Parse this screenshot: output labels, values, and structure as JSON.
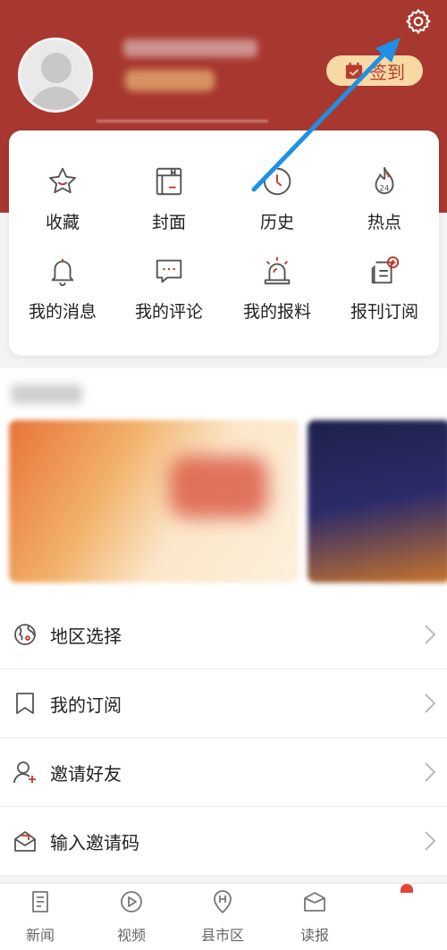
{
  "header": {
    "signin_label": "签到",
    "icons": [
      "settings-gear-icon",
      "calendar-check-icon"
    ]
  },
  "quick_grid": [
    {
      "label": "收藏",
      "icon": "star-icon"
    },
    {
      "label": "封面",
      "icon": "newspaper-cover-icon"
    },
    {
      "label": "历史",
      "icon": "clock-icon"
    },
    {
      "label": "热点",
      "icon": "flame-24-icon"
    },
    {
      "label": "我的消息",
      "icon": "bell-icon"
    },
    {
      "label": "我的评论",
      "icon": "comment-bubble-icon"
    },
    {
      "label": "我的报料",
      "icon": "siren-icon"
    },
    {
      "label": "报刊订阅",
      "icon": "paper-subscribe-icon"
    }
  ],
  "menu": [
    {
      "label": "地区选择",
      "icon": "globe-location-icon"
    },
    {
      "label": "我的订阅",
      "icon": "bookmark-icon"
    },
    {
      "label": "邀请好友",
      "icon": "add-user-icon"
    },
    {
      "label": "输入邀请码",
      "icon": "invite-code-icon"
    }
  ],
  "tabbar": [
    {
      "label": "新闻",
      "icon": "news-doc-icon"
    },
    {
      "label": "视频",
      "icon": "play-circle-icon"
    },
    {
      "label": "县市区",
      "icon": "location-h-icon"
    },
    {
      "label": "读报",
      "icon": "open-book-icon"
    }
  ],
  "colors": {
    "brand": "#a8382f",
    "signin_bg": "#f6d9a3",
    "icon_red": "#c0392b",
    "arrow": "#1e90e6"
  }
}
